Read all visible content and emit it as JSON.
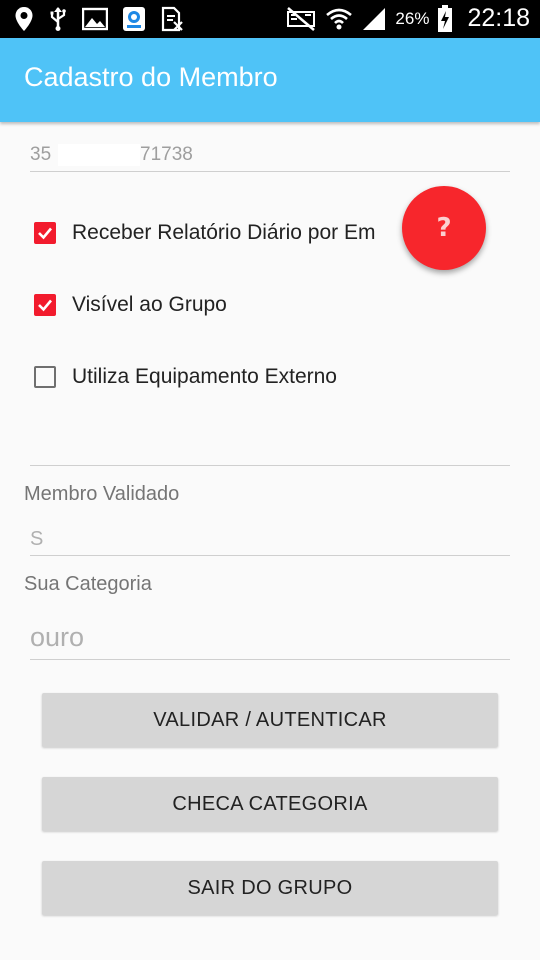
{
  "status_bar": {
    "battery_percent": "26%",
    "time": "22:18",
    "left_icons": [
      "location-icon",
      "usb-icon",
      "image-icon",
      "app-notification-icon",
      "no-sim-icon"
    ],
    "right_icons": [
      "mute-icon",
      "wifi-icon",
      "signal-icon",
      "battery-charging-icon"
    ]
  },
  "app_bar": {
    "title": "Cadastro do Membro"
  },
  "phone_field": {
    "value_start": "35",
    "value_end": "71738"
  },
  "checkboxes": [
    {
      "label": "Receber Relatório Diário por Em",
      "checked": true
    },
    {
      "label": "Visível ao Grupo",
      "checked": true
    },
    {
      "label": "Utiliza Equipamento Externo",
      "checked": false
    }
  ],
  "help_fab": {
    "label": "?",
    "color": "#f7262c"
  },
  "validated": {
    "label": "Membro Validado",
    "value": "S"
  },
  "category": {
    "label": "Sua Categoria",
    "value": "ouro"
  },
  "buttons": {
    "validate": "VALIDAR / AUTENTICAR",
    "check_category": "CHECA CATEGORIA",
    "leave_group": "SAIR DO GRUPO"
  },
  "colors": {
    "app_bar": "#4fc3f7",
    "checkbox_checked": "#f21b2d",
    "button_bg": "#d6d6d6"
  }
}
